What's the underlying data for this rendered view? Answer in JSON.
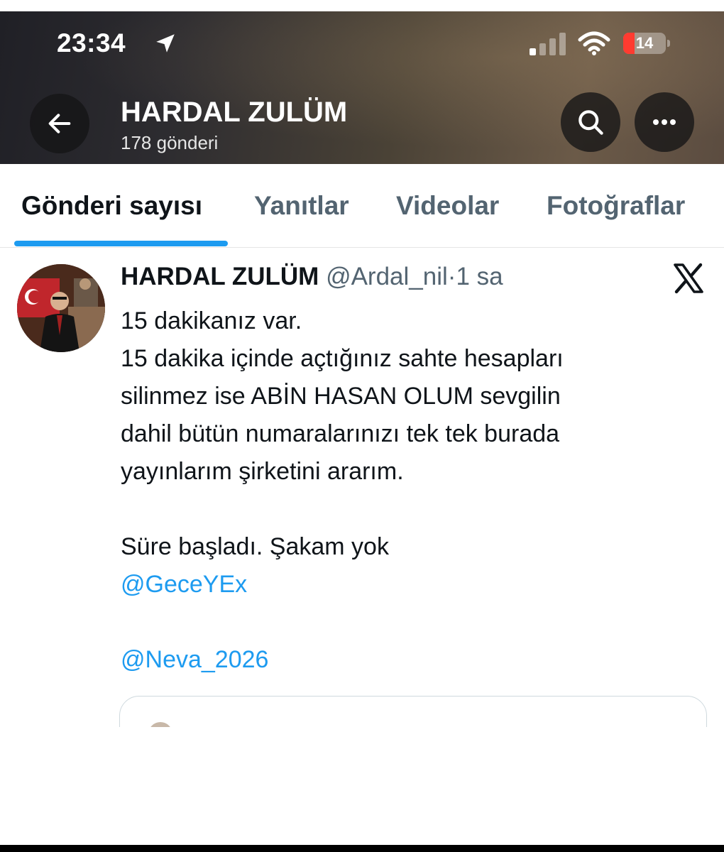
{
  "status_bar": {
    "time": "23:34",
    "battery_level": "14",
    "icons": [
      "location-arrow-icon",
      "cellular-signal-icon",
      "wifi-icon",
      "battery-icon"
    ]
  },
  "header": {
    "profile_name": "HARDAL ZULÜM",
    "post_count": "178 gönderi",
    "icons": [
      "back-arrow-icon",
      "search-icon",
      "more-icon"
    ]
  },
  "tabs": [
    {
      "label": "Gönderi sayısı",
      "active": true
    },
    {
      "label": "Yanıtlar",
      "active": false
    },
    {
      "label": "Videolar",
      "active": false
    },
    {
      "label": "Fotoğraflar",
      "active": false
    }
  ],
  "tweet": {
    "author_name": "HARDAL ZULÜM",
    "handle": "@Ardal_nil",
    "separator": "·",
    "time_ago": "1 sa",
    "lines": [
      "15 dakikanız var.",
      "15 dakika içinde açtığınız sahte hesapları",
      "silinmez ise ABİN HASAN OLUM sevgilin",
      "dahil bütün numaralarınızı tek tek burada",
      "yayınlarım şirketini ararım.",
      "Süre başladı. Şakam yok"
    ],
    "mentions": [
      "@GeceYEx",
      "@Neva_2026"
    ],
    "source_icon": "x-logo-icon"
  },
  "colors": {
    "accent": "#1d9bf0",
    "text_primary": "#0f1419",
    "text_secondary": "#536471",
    "battery_low": "#ff3b30"
  }
}
